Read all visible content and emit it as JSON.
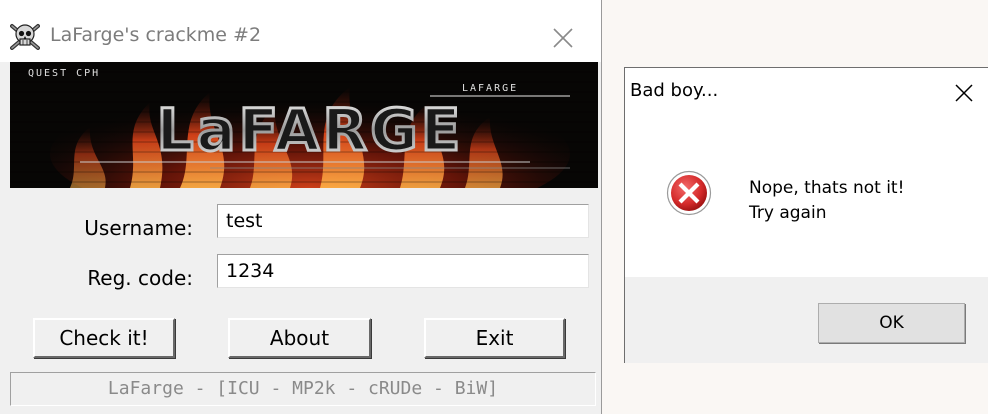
{
  "main_window": {
    "title": "LaFarge's crackme #2",
    "banner": {
      "top_left_tag": "QUEST CPH",
      "top_right_tag": "LAFARGE",
      "logo_text": "LaFARGE"
    },
    "username_label": "Username:",
    "username_value": "test",
    "regcode_label": "Reg. code:",
    "regcode_value": "1234",
    "buttons": {
      "check": "Check it!",
      "about": "About",
      "exit": "Exit"
    },
    "status_text": "LaFarge - [ICU - MP2k - cRUDe - BiW]"
  },
  "message_box": {
    "title": "Bad boy...",
    "icon": "error-icon",
    "message_line1": "Nope, thats not it!",
    "message_line2": "Try again",
    "ok_label": "OK"
  },
  "colors": {
    "error_red": "#d42a2a",
    "window_bg": "#f0f0f0",
    "status_text": "#8a8a8a"
  }
}
